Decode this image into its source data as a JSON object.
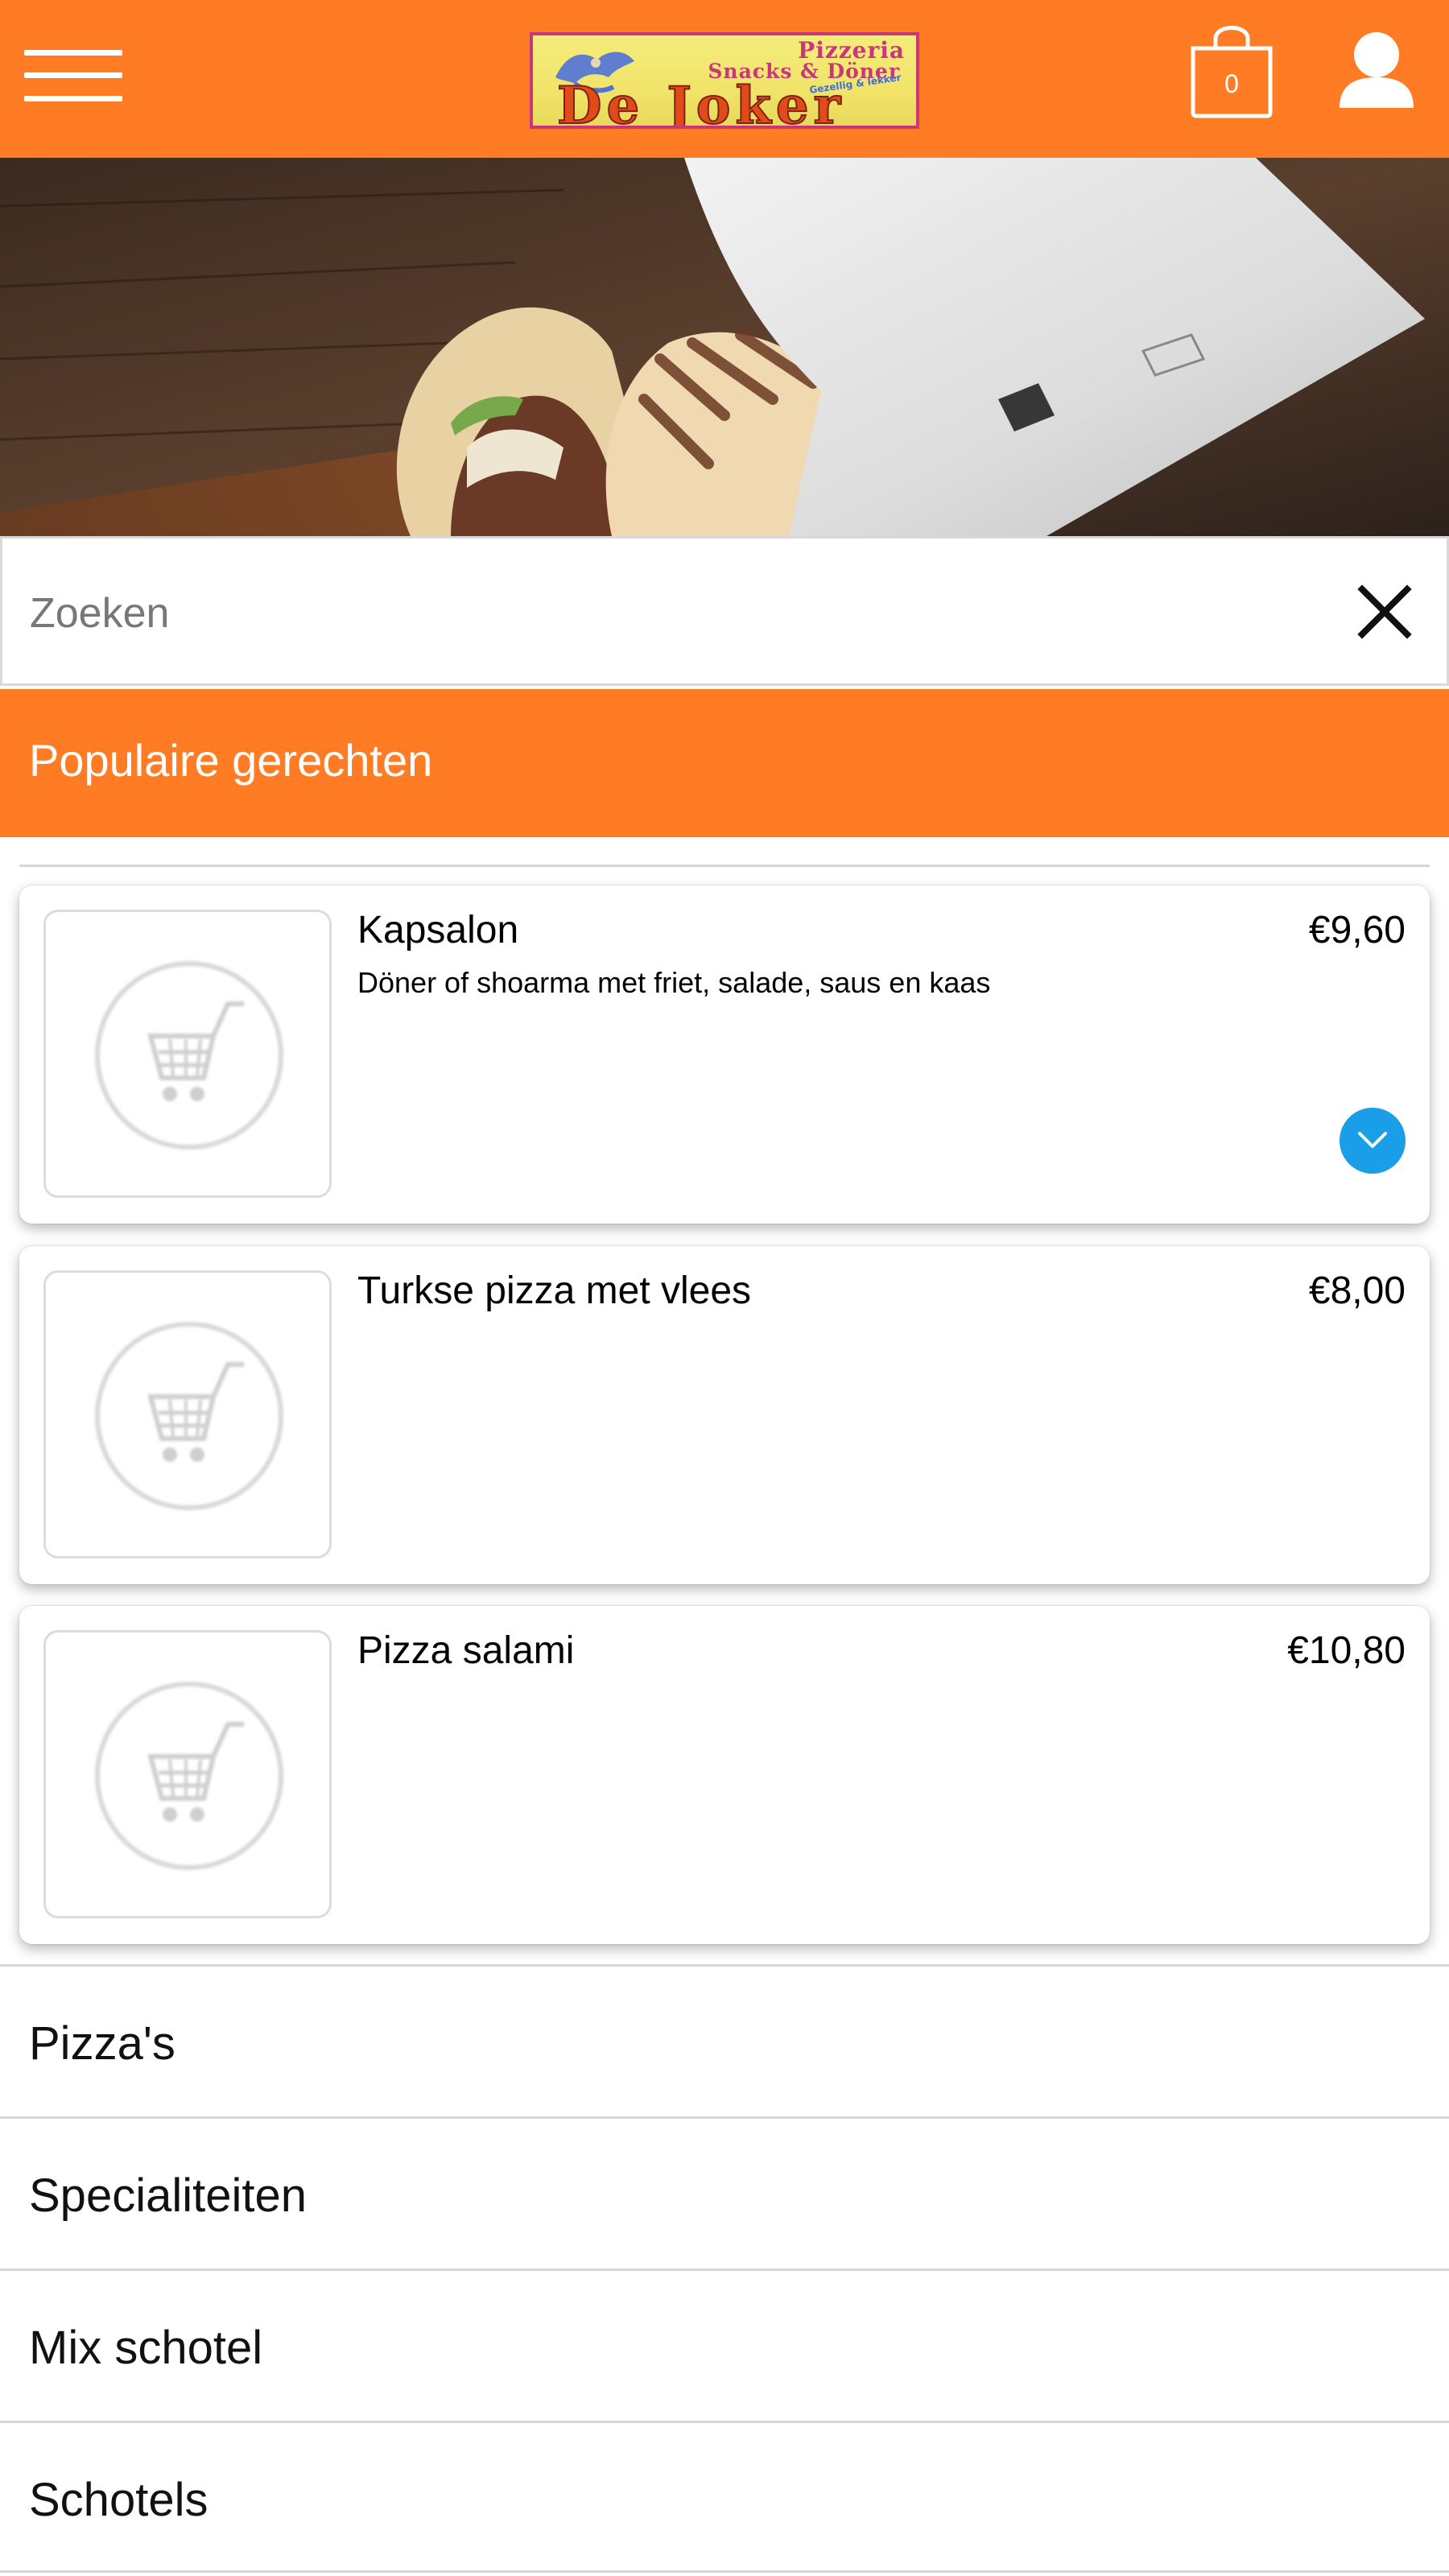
{
  "header": {
    "logo": {
      "line1": "Pizzeria",
      "line2": "Snacks & Döner",
      "small": "Gezellig & lekker",
      "main": "De Joker"
    },
    "cart_count": "0",
    "colors": {
      "brand": "#ff7b24"
    }
  },
  "search": {
    "placeholder": "Zoeken"
  },
  "popular": {
    "title": "Populaire gerechten",
    "items": [
      {
        "name": "Kapsalon",
        "price": "€9,60",
        "description": "Döner of shoarma met friet, salade, saus en kaas"
      },
      {
        "name": "Turkse pizza met vlees",
        "price": "€8,00",
        "description": ""
      },
      {
        "name": "Pizza salami",
        "price": "€10,80",
        "description": ""
      }
    ]
  },
  "categories": [
    {
      "label": "Pizza's"
    },
    {
      "label": "Specialiteiten"
    },
    {
      "label": "Mix schotel"
    },
    {
      "label": "Schotels"
    }
  ],
  "icons": {
    "menu": "hamburger-icon",
    "cart": "shopping-bag-icon",
    "account": "user-icon",
    "clear": "close-icon",
    "expand": "chevron-down-icon",
    "placeholder": "cart-placeholder-icon"
  }
}
